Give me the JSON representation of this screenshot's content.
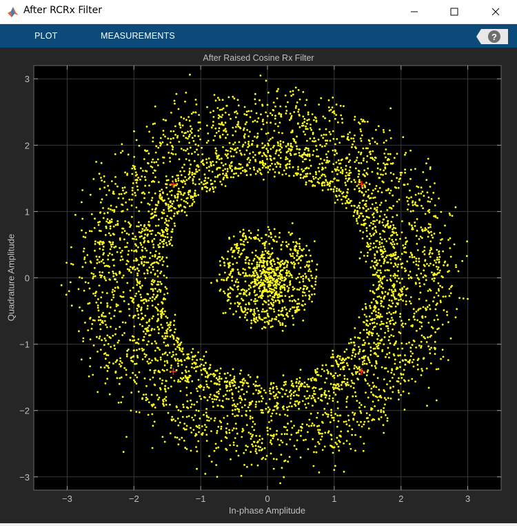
{
  "window": {
    "title": "After RCRx Filter",
    "controls": [
      "minimize",
      "maximize",
      "close"
    ]
  },
  "toolstrip": {
    "tabs": [
      {
        "label": "PLOT"
      },
      {
        "label": "MEASUREMENTS"
      }
    ],
    "help_icon": "help-icon"
  },
  "colors": {
    "toolstrip": "#0c4a7a",
    "figure_bg": "#262626",
    "axes_bg": "#000000",
    "points": "#ffff14",
    "reference": "#ff2a2a",
    "grid": "#3a3a3a",
    "text": "#bfbfbf"
  },
  "chart_data": {
    "type": "scatter",
    "title": "After Raised Cosine Rx Filter",
    "xlabel": "In-phase Amplitude",
    "ylabel": "Quadrature Amplitude",
    "xlim": [
      -3.5,
      3.5
    ],
    "ylim": [
      -3.2,
      3.2
    ],
    "xticks": [
      -3,
      -2,
      -1,
      0,
      1,
      2,
      3
    ],
    "yticks": [
      -3,
      -2,
      -1,
      0,
      1,
      2,
      3
    ],
    "grid": true,
    "series": [
      {
        "style": "points",
        "color": "#ffff14",
        "clusters": [
          {
            "shape": "ring",
            "center": [
              0,
              0
            ],
            "radius": 0.25,
            "spread": 0.12,
            "count": 450
          },
          {
            "shape": "ring",
            "center": [
              0,
              0
            ],
            "radius": 0.62,
            "spread": 0.09,
            "count": 400
          },
          {
            "shape": "ring",
            "center": [
              0,
              0
            ],
            "radius": 1.68,
            "spread": 0.08,
            "count": 1100
          },
          {
            "shape": "ring",
            "center": [
              0,
              0
            ],
            "radius": 1.95,
            "spread": 0.08,
            "count": 1000
          },
          {
            "shape": "ring",
            "center": [
              0,
              0
            ],
            "radius": 2.45,
            "spread": 0.25,
            "count": 2100
          }
        ]
      },
      {
        "style": "reference-markers",
        "color": "#ff2a2a",
        "points": [
          [
            1.41,
            1.41
          ],
          [
            -1.41,
            1.41
          ],
          [
            -1.41,
            -1.41
          ],
          [
            1.41,
            -1.41
          ]
        ]
      }
    ]
  }
}
